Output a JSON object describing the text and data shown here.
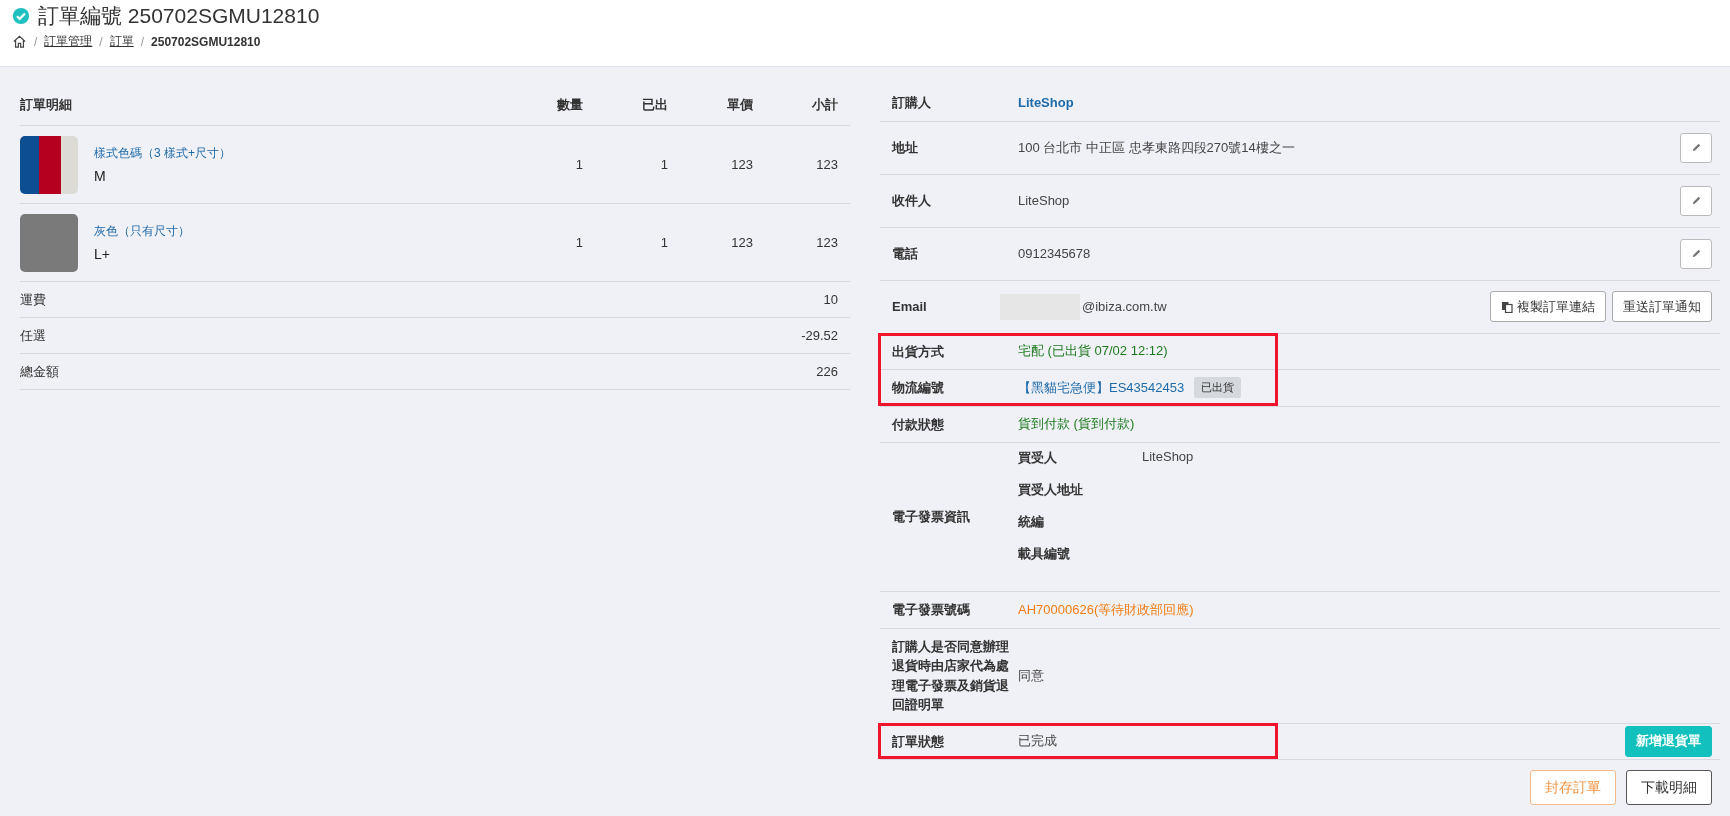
{
  "header": {
    "title": "訂單編號 250702SGMU12810",
    "breadcrumb_separator": "/",
    "breadcrumb": [
      {
        "label": "訂單管理",
        "kind": "link"
      },
      {
        "label": "訂單",
        "kind": "link"
      },
      {
        "label": "250702SGMU12810",
        "kind": "current"
      }
    ]
  },
  "order_table": {
    "columns": [
      "訂單明細",
      "數量",
      "已出",
      "單價",
      "小計"
    ],
    "items": [
      {
        "name": "樣式色碼（3 樣式+尺寸）",
        "variant": "M",
        "kind": "striped",
        "qty": "1",
        "shipped": "1",
        "price": "123",
        "subtotal": "123"
      },
      {
        "name": "灰色（只有尺寸）",
        "variant": "L+",
        "kind": "plain",
        "qty": "1",
        "shipped": "1",
        "price": "123",
        "subtotal": "123"
      }
    ],
    "summary": [
      {
        "label": "運費",
        "value": "10"
      },
      {
        "label": "任選",
        "value": "-29.52"
      },
      {
        "label": "總金額",
        "value": "226"
      }
    ]
  },
  "info_sections": [
    {
      "highlighted": false,
      "rows": [
        {
          "label": "訂購人",
          "kind": "link",
          "value": "LiteShop"
        },
        {
          "label": "地址",
          "kind": "text",
          "value": "100 台北市 中正區 忠孝東路四段270號14樓之一",
          "editable": true
        },
        {
          "label": "收件人",
          "kind": "text",
          "value": "LiteShop",
          "editable": true
        },
        {
          "label": "電話",
          "kind": "text",
          "value": "0912345678",
          "editable": true
        },
        {
          "label": "Email",
          "kind": "email",
          "value": "@ibiza.com.tw",
          "actions": [
            {
              "label": "複製訂單連結",
              "kind": "copy"
            },
            {
              "label": "重送訂單通知",
              "kind": "default"
            }
          ]
        }
      ]
    },
    {
      "highlighted": true,
      "rows": [
        {
          "label": "出貨方式",
          "kind": "success",
          "value": "宅配 (已出貨 07/02 12:12)"
        },
        {
          "label": "物流編號",
          "kind": "tracking",
          "value": "【黑貓宅急便】ES43542453",
          "badge": "已出貨"
        }
      ]
    },
    {
      "highlighted": false,
      "rows": [
        {
          "label": "付款狀態",
          "kind": "success",
          "value": "貨到付款 (貨到付款)"
        },
        {
          "label": "電子發票資訊",
          "kind": "details",
          "details": [
            {
              "label": "買受人",
              "value": "LiteShop"
            },
            {
              "label": "買受人地址"
            },
            {
              "label": "統編"
            },
            {
              "label": "載具編號"
            }
          ]
        },
        {
          "label": "電子發票號碼",
          "kind": "warning",
          "value": "AH70000626(等待財政部回應)"
        },
        {
          "label": "訂購人是否同意辦理退貨時由店家代為處理電子發票及銷貨退回證明單",
          "kind": "text",
          "value": "同意"
        }
      ]
    },
    {
      "highlighted": true,
      "rows": [
        {
          "label": "訂單狀態",
          "kind": "text",
          "value": "已完成",
          "actions": [
            {
              "label": "新增退貨單",
              "kind": "primary"
            }
          ]
        }
      ]
    }
  ],
  "footer_buttons": [
    {
      "label": "封存訂單",
      "kind": "warning"
    },
    {
      "label": "下載明細",
      "kind": "default"
    }
  ]
}
